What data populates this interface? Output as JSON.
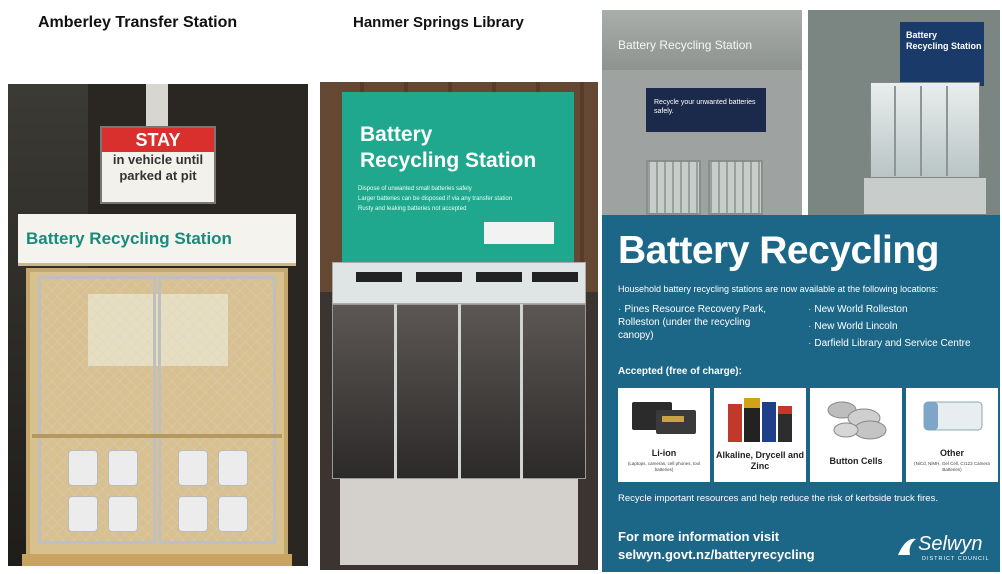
{
  "captions": {
    "amberley": "Amberley Transfer Station",
    "hanmer": "Hanmer Springs Library"
  },
  "amberley_photo": {
    "stay_sign": {
      "headline": "STAY",
      "line1": "in vehicle until",
      "line2": "parked at pit"
    },
    "roof_sign": "Battery Recycling Station"
  },
  "hanmer_photo": {
    "sign_title_line1": "Battery",
    "sign_title_line2": "Recycling Station",
    "sign_lines": [
      "Dispose of unwanted small batteries safely",
      "Larger batteries can be disposed if via any transfer station",
      "Rusty and leaking batteries not accepted"
    ]
  },
  "cabinet_photo": {
    "title": "Battery Recycling Station",
    "panel_text": "Recycle your unwanted batteries safely."
  },
  "bin_photo": {
    "title_line1": "Battery",
    "title_line2": "Recycling Station"
  },
  "poster": {
    "title": "Battery Recycling",
    "intro": "Household battery recycling stations are now available at the following locations:",
    "locations_left": [
      "Pines Resource Recovery Park, Rolleston (under the recycling canopy)"
    ],
    "locations_right": [
      "New World Rolleston",
      "New World Lincoln",
      "Darfield Library and Service Centre"
    ],
    "accepted_heading": "Accepted (free of charge):",
    "battery_types": [
      {
        "name": "Li-ion",
        "note": "(Laptops, cameras, cell phones, tool batteries)"
      },
      {
        "name": "Alkaline, Drycell and Zinc",
        "note": ""
      },
      {
        "name": "Button Cells",
        "note": ""
      },
      {
        "name": "Other",
        "note": "(NiCd, NiMH, Gel Cell, Cr123 Camera Batteries)"
      }
    ],
    "recycle_line": "Recycle important resources and help reduce the risk of kerbside truck fires.",
    "more_info": "For more information visit",
    "url": "selwyn.govt.nz/batteryrecycling",
    "logo_name": "Selwyn",
    "logo_sub": "DISTRICT COUNCIL"
  }
}
